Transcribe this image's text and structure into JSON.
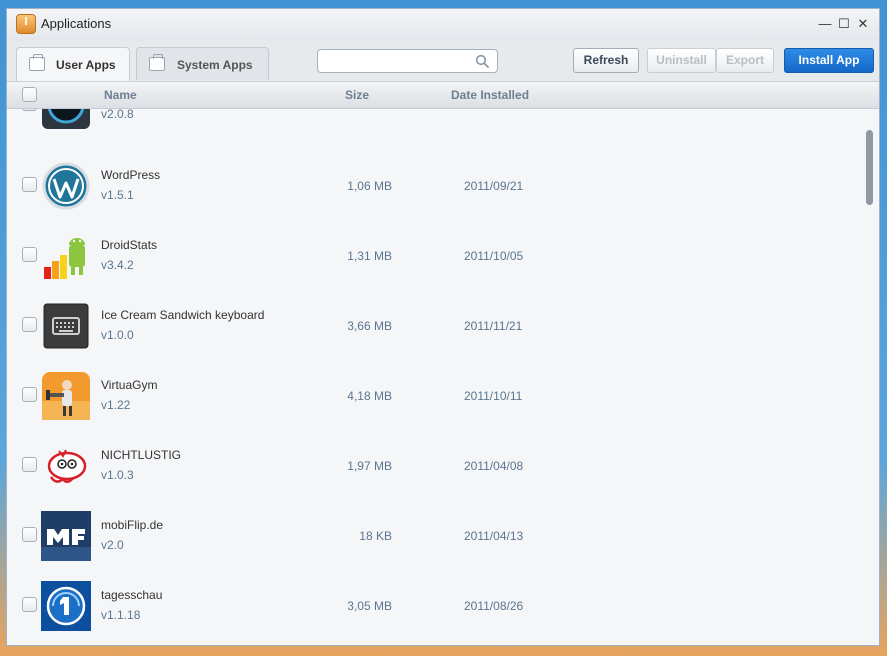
{
  "window": {
    "title": "Applications"
  },
  "window_controls": {
    "minimize": "—",
    "maximize": "☐",
    "close": "✕"
  },
  "tabs": [
    {
      "label": "User Apps",
      "active": true
    },
    {
      "label": "System Apps",
      "active": false
    }
  ],
  "search": {
    "value": "",
    "placeholder": ""
  },
  "buttons": {
    "refresh": "Refresh",
    "uninstall": "Uninstall",
    "export": "Export",
    "install": "Install App"
  },
  "columns": {
    "name": "Name",
    "size": "Size",
    "date": "Date Installed"
  },
  "apps": [
    {
      "name": "",
      "version": "v2.0.8",
      "size": "",
      "date": "",
      "icon": "speedometer-app-icon"
    },
    {
      "name": "WordPress",
      "version": "v1.5.1",
      "size": "1,06 MB",
      "date": "2011/09/21",
      "icon": "wordpress-app-icon"
    },
    {
      "name": "DroidStats",
      "version": "v3.4.2",
      "size": "1,31 MB",
      "date": "2011/10/05",
      "icon": "droidstats-app-icon"
    },
    {
      "name": "Ice Cream Sandwich keyboard",
      "version": "v1.0.0",
      "size": "3,66 MB",
      "date": "2011/11/21",
      "icon": "keyboard-app-icon"
    },
    {
      "name": "VirtuaGym",
      "version": "v1.22",
      "size": "4,18 MB",
      "date": "2011/10/11",
      "icon": "virtuagym-app-icon"
    },
    {
      "name": "NICHTLUSTIG",
      "version": "v1.0.3",
      "size": "1,97 MB",
      "date": "2011/04/08",
      "icon": "nichtlustig-app-icon"
    },
    {
      "name": "mobiFlip.de",
      "version": "v2.0",
      "size": "18 KB",
      "date": "2011/04/13",
      "icon": "mobiflip-app-icon"
    },
    {
      "name": "tagesschau",
      "version": "v1.1.18",
      "size": "3,05 MB",
      "date": "2011/08/26",
      "icon": "tagesschau-app-icon"
    }
  ],
  "colors": {
    "accent": "#1a73d9",
    "link_text": "#5d7590"
  }
}
